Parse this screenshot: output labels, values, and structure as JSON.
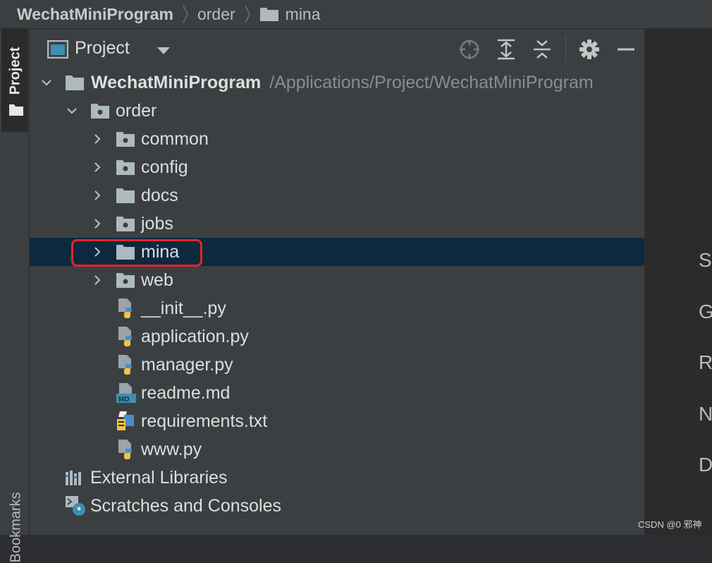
{
  "breadcrumb": [
    "WechatMiniProgram",
    "order",
    "mina"
  ],
  "side_stripe": {
    "project_label": "Project",
    "bookmarks_label": "Bookmarks"
  },
  "panel": {
    "title": "Project"
  },
  "tree": {
    "root": {
      "label": "WechatMiniProgram",
      "path": "/Applications/Project/WechatMiniProgram"
    },
    "order": "order",
    "folders": [
      "common",
      "config",
      "docs",
      "jobs",
      "mina",
      "web"
    ],
    "files": [
      "__init__.py",
      "application.py",
      "manager.py",
      "readme.md",
      "requirements.txt",
      "www.py"
    ],
    "external_libraries": "External Libraries",
    "scratches": "Scratches and Consoles"
  },
  "editor_hints": [
    "S",
    "G",
    "R",
    "N",
    "D"
  ],
  "watermark": "CSDN @0 邪神",
  "colors": {
    "selection": "#0d293e",
    "highlight_border": "#e8232a",
    "panel_bg": "#3c3f41"
  }
}
